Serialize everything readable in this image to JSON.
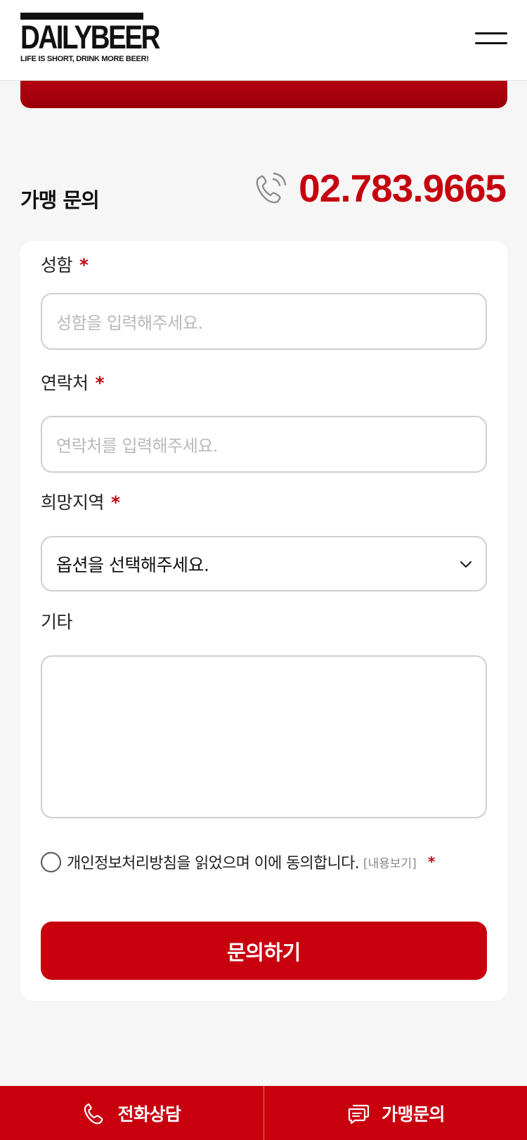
{
  "header": {
    "logo_text": "DAILYBEER",
    "logo_tagline": "LIFE IS SHORT, DRINK MORE BEER!",
    "menu_icon": "hamburger-icon"
  },
  "section": {
    "title": "가맹 문의",
    "phone_icon": "phone-ringing-icon",
    "phone_number": "02.783.9665"
  },
  "form": {
    "name": {
      "label": "성함",
      "required_mark": "*",
      "placeholder": "성함을 입력해주세요."
    },
    "contact": {
      "label": "연락처",
      "required_mark": "*",
      "placeholder": "연락처를 입력해주세요."
    },
    "region": {
      "label": "희망지역",
      "required_mark": "*",
      "selected": "옵션을 선택해주세요.",
      "icon": "chevron-down-icon"
    },
    "etc": {
      "label": "기타",
      "value": ""
    },
    "agree": {
      "text": "개인정보처리방침을 읽었으며 이에 동의합니다.",
      "link": "[내용보기]",
      "required_mark": "*"
    },
    "submit_label": "문의하기"
  },
  "bottom_bar": {
    "call": {
      "label": "전화상담",
      "icon": "phone-icon"
    },
    "inquiry": {
      "label": "가맹문의",
      "icon": "chat-icon"
    }
  },
  "colors": {
    "accent": "#c8000e",
    "background": "#f6f6f6",
    "card": "#ffffff"
  }
}
